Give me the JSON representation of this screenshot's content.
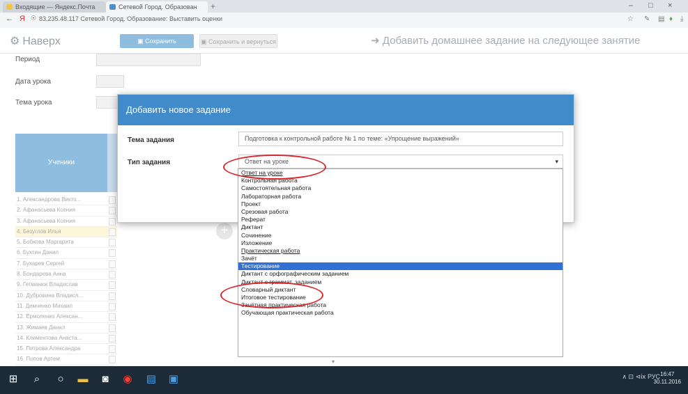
{
  "browser": {
    "tabs": [
      {
        "label": "Входящие — Яндекс.Почта",
        "color": "#f5c542"
      },
      {
        "label": "Сетевой Город. Образован",
        "color": "#4a8fd4"
      }
    ],
    "new_tab": "+",
    "url": "83.235.48.117   Сетевой Город. Образование: Выставить оценки",
    "window_controls": [
      "–",
      "□",
      "×"
    ]
  },
  "toolbar": {
    "back_label": "Наверх",
    "save_label": "Сохранить",
    "save2_label": "Сохранить и вернуться",
    "add_homework": "Добавить домашнее задание на следующее занятие"
  },
  "form": {
    "period_label": "Период",
    "lesson_date_label": "Дата урока",
    "lesson_topic_label": "Тема урока"
  },
  "table": {
    "header": "Ученики",
    "students": [
      "1. Александрова Викто...",
      "2. Афанасьева Ксения",
      "3. Афанасьева Ксения",
      "4. Безуглов Илья",
      "5. Бобкова Маргарита",
      "6. Бухтин Данил",
      "7. Бухарев Сергей",
      "8. Бондарева Анна",
      "9. Гетманюк Владислав",
      "10. Дубровина Владисл...",
      "11. Демченко Михаил",
      "12. Ермоленко Алексан...",
      "13. Жимаев Данил",
      "14. Климентова Анаста...",
      "15. Петрова Александра",
      "16. Попов Артем"
    ]
  },
  "dialog": {
    "title": "Добавить новое задание",
    "topic_label": "Тема задания",
    "topic_value": "Подготовка к контрольной работе № 1 по теме: «Упрощение выражений»",
    "type_label": "Тип задания",
    "type_value": "Ответ на уроке",
    "options": [
      "Ответ на уроке",
      "Контрольная работа",
      "Самостоятельная работа",
      "Лабораторная работа",
      "Проект",
      "Срезовая работа",
      "Реферат",
      "Диктант",
      "Сочинение",
      "Изложение",
      "Практическая работа",
      "Зачёт",
      "Тестирование",
      "Диктант с орфографическим заданием",
      "Диктант с граммат. заданием",
      "Словарный диктант",
      "Итоговое тестирование",
      "Зачётная практическая работа",
      "Обучающая практическая работа"
    ],
    "selected_option": "Тестирование"
  },
  "taskbar": {
    "tray": "∧  ⊡  ⊲ⅸ  РУС",
    "time": "16:47",
    "date": "30.11.2016"
  },
  "colors": {
    "dialog_header": "#428bca",
    "selected_option": "#3370d6",
    "annotation": "#d9262b",
    "taskbar": "#1d2a38"
  }
}
